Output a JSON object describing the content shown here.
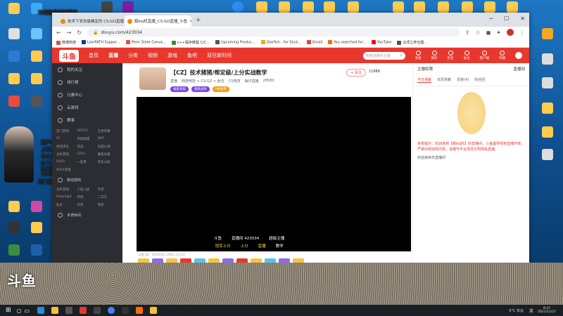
{
  "desktop": {
    "overlay_logo": "斗鱼",
    "stream_chat": [
      {
        "text": "冷雨弦音谈笑落花",
        "color": "#ffffff"
      },
      {
        "text": "用户:靓仔白猫",
        "color": "#ffffff"
      },
      {
        "text": "上车三把",
        "color": "#ffd84d"
      },
      {
        "text": "冬久五位一两个",
        "color": "#9ff26b"
      },
      {
        "text": "中了点什么",
        "color": "#ffd84d"
      },
      {
        "text": "带大哥你说了算",
        "color": "#9ff26b"
      },
      {
        "text": "1587212",
        "color": "#ffd84d"
      },
      {
        "text": "进门就点点关注就出金",
        "color": "#9ff26b"
      }
    ]
  },
  "browser": {
    "tabs": [
      {
        "title": "技术下发你最确定的 CS:GO直播"
      },
      {
        "title": "鹅koj机直播_CS:GO直播_斗鱼"
      }
    ],
    "url": "douyu.com/423034",
    "bookmarks": [
      "微博热搜",
      "LionPATH Suppor...",
      "Penn State Canva...",
      "c++程序教程 C/C...",
      "Upcoming Produc...",
      "Starfish - for Stud...",
      "Gmail",
      "You searched for...",
      "YouTube",
      "云顶之弈全图..."
    ],
    "window_controls": {
      "minimize": "─",
      "maximize": "☐",
      "close": "✕"
    }
  },
  "douyu": {
    "logo": "斗鱼",
    "nav": [
      "首页",
      "直播",
      "分类",
      "视频",
      "游戏",
      "鱼吧",
      "双旦新时间"
    ],
    "search_placeholder": "搜索直播的主播",
    "header_icons": [
      "消息",
      "我的",
      "历史",
      "关注",
      "客户端",
      "开播"
    ],
    "sidebar": {
      "items": [
        "我的关注",
        "排行榜",
        "元素中心",
        "云游戏",
        "赛事"
      ],
      "grid": [
        "热门游戏",
        "DOTA2",
        "王者荣耀",
        "CF",
        "英雄联盟",
        "DNF",
        "绝地求生",
        "诛战",
        "穿越火线",
        "主机游戏",
        "GTA5",
        "魔兽争霸",
        "SUSA",
        "一起看",
        "更多分类",
        "APEX英雄"
      ],
      "group2_title": "移动游戏",
      "group2": [
        "主机游戏",
        "小鱼儿园",
        "手游",
        "Propnight",
        "传奇",
        "二次元",
        "鱼乐",
        "日常",
        "萌宠"
      ],
      "group3_title": "手游休闲"
    },
    "room": {
      "title": "【CZ】技术猪猪/帮定级/上分实战教学",
      "meta": [
        "直播",
        "网游竞技 > CS:GO > 射击",
        "CS竞技",
        "每日直播",
        "28580"
      ],
      "badges": [
        {
          "text": "福星高照",
          "color": "#7b3fe4"
        },
        {
          "text": "超级战争",
          "color": "#7b3fe4"
        },
        {
          "text": "MR榜单",
          "color": "#f39c12"
        }
      ],
      "follow_label": "+ 关注",
      "fans": "11888",
      "video_overlay": [
        "斗鱼",
        "直播间 423034",
        "超级主播",
        "冠军上分",
        "上分",
        "直播",
        "教学"
      ],
      "footer": "斗鱼 ID：423034 | 2021.12.27"
    },
    "right_panel": {
      "tabs": [
        "今日贡献",
        "本周贡献",
        "贵族(4)",
        "粉丝团"
      ],
      "header": "主播权限",
      "sub_header": "直播间",
      "system_msg": "系统提示：欢迎来到【鹅koj的】的直播间，斗鱼倡导绿色直播环境，严禁出现违规内容，请遵守平台规范文明观看直播。",
      "welcome": "欢迎来到本直播间"
    }
  },
  "taskbar": {
    "time": "8:47",
    "date": "2021/12/27",
    "weather": "0°C 多云",
    "lang": "英"
  },
  "colors": {
    "douyu_red": "#e8372d",
    "desktop_blue": "#1e78c4",
    "sidebar_bg": "#2b2d33"
  }
}
